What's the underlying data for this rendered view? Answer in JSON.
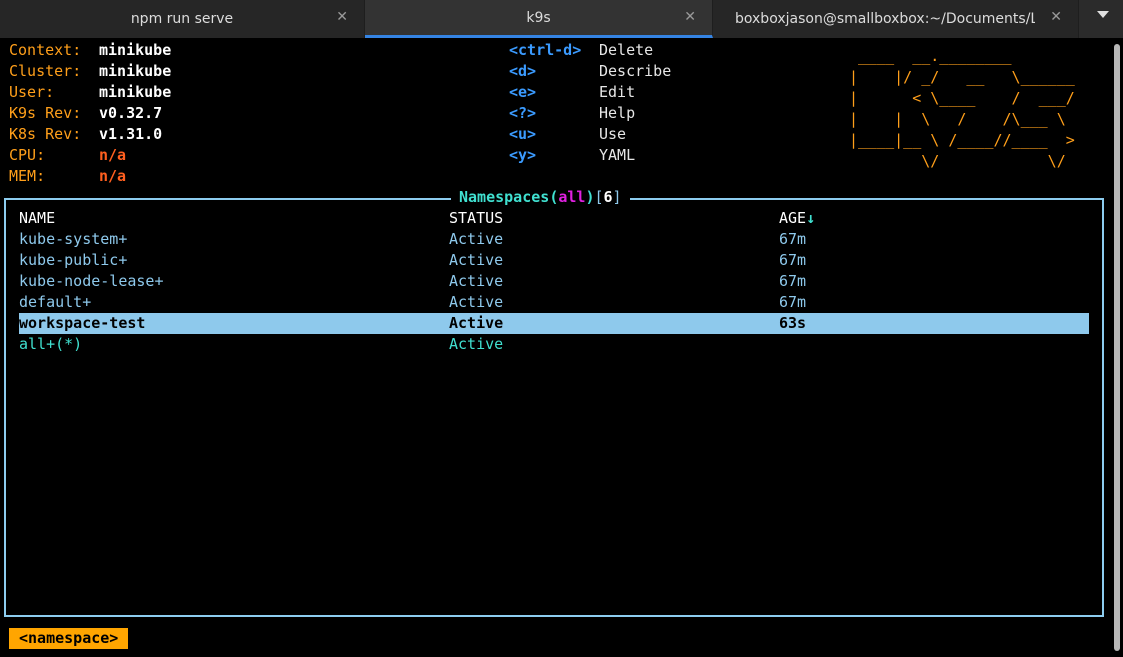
{
  "tabs": [
    {
      "label": "npm run serve",
      "close": "✕"
    },
    {
      "label": "k9s",
      "close": "✕"
    },
    {
      "label": "boxboxjason@smallboxbox:~/Documents/L...",
      "close": "✕"
    }
  ],
  "info": {
    "context_label": "Context:",
    "context": "minikube",
    "cluster_label": "Cluster:",
    "cluster": "minikube",
    "user_label": "User:",
    "user": "minikube",
    "k9s_rev_label": "K9s Rev:",
    "k9s_rev": "v0.32.7",
    "k8s_rev_label": "K8s Rev:",
    "k8s_rev": "v1.31.0",
    "cpu_label": "CPU:",
    "cpu": "n/a",
    "mem_label": "MEM:",
    "mem": "n/a"
  },
  "shortcuts": [
    {
      "key": "<ctrl-d>",
      "action": "Delete"
    },
    {
      "key": "<d>",
      "action": "Describe"
    },
    {
      "key": "<e>",
      "action": "Edit"
    },
    {
      "key": "<?>",
      "action": "Help"
    },
    {
      "key": "<u>",
      "action": "Use"
    },
    {
      "key": "<y>",
      "action": "YAML"
    }
  ],
  "logo": " ____  __.________\n|    |/ _/   __   \\______\n|      < \\____    /  ___/\n|    |  \\   /    /\\___ \\\n|____|__ \\ /____//____  >\n        \\/            \\/",
  "panel": {
    "title": "Namespaces",
    "paren_open": "(",
    "filter": "all",
    "paren_close": ")",
    "br_open": "[",
    "count": "6",
    "br_close": "]"
  },
  "table": {
    "headers": [
      "NAME",
      "STATUS",
      "AGE"
    ],
    "sort_indicator": "↓",
    "rows": [
      [
        "kube-system+",
        "Active",
        "67m"
      ],
      [
        "kube-public+",
        "Active",
        "67m"
      ],
      [
        "kube-node-lease+",
        "Active",
        "67m"
      ],
      [
        "default+",
        "Active",
        "67m"
      ],
      [
        "workspace-test",
        "Active",
        "63s"
      ],
      [
        "all+(*)",
        "Active",
        ""
      ]
    ]
  },
  "breadcrumb": "<namespace>",
  "colors": {
    "accent_tab": "#3584e4",
    "label_orange": "#ff9f1a",
    "border_blue": "#8dcdef",
    "selection": "#8ec9ec",
    "crumb_bg": "#ffa500"
  }
}
